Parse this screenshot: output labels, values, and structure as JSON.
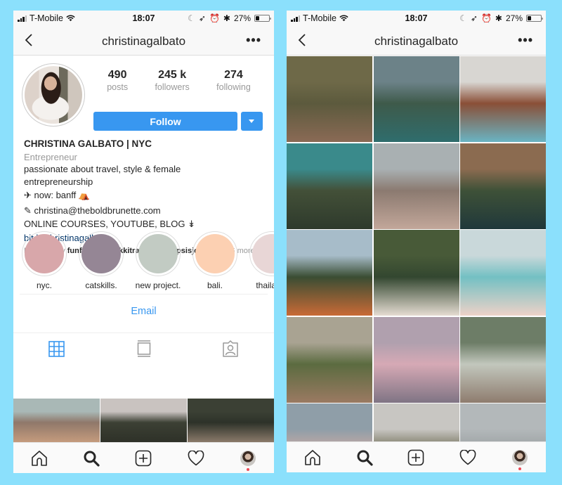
{
  "status_bar": {
    "carrier": "T-Mobile",
    "time": "18:07",
    "battery": "27%",
    "battery_level": 0.27,
    "icons": [
      "signal-icon",
      "wifi-icon",
      "moon-icon",
      "location-icon",
      "alarm-icon",
      "bluetooth-icon",
      "battery-icon"
    ]
  },
  "navbar": {
    "title": "christinagalbato",
    "back_icon": "chevron-left-icon",
    "more_label": "•••"
  },
  "profile": {
    "stats": [
      {
        "value": "490",
        "label": "posts"
      },
      {
        "value": "245 k",
        "label": "followers"
      },
      {
        "value": "274",
        "label": "following"
      }
    ],
    "follow_label": "Follow",
    "name": "CHRISTINA GALBATO | NYC",
    "category": "Entrepreneur",
    "bio_lines": [
      "passionate about travel, style & female",
      "entrepreneurship",
      "✈ now: banff ⛺",
      "✎ christina@theboldbrunette.com",
      "ONLINE COURSES, YOUTUBE, BLOG ↡"
    ],
    "link": "bit.ly/christinagalbato",
    "followed_by_prefix": "Followed by ",
    "followed_by_names": [
      "funforlouis",
      "nikkitravelled",
      "ellipsisjournals"
    ],
    "followed_by_suffix": " + 6 more"
  },
  "highlights": [
    {
      "label": "nyc.",
      "color": "#d8a7aa"
    },
    {
      "label": "catskills.",
      "color": "#958695"
    },
    {
      "label": "new project.",
      "color": "#c2cbc3"
    },
    {
      "label": "bali.",
      "color": "#fcd0b2"
    },
    {
      "label": "thailand.",
      "color": "#e8d6d6"
    }
  ],
  "email_label": "Email",
  "profile_tabs": [
    {
      "name": "grid",
      "icon": "grid-icon",
      "active": true
    },
    {
      "name": "feed",
      "icon": "feed-icon",
      "active": false
    },
    {
      "name": "tagged",
      "icon": "tagged-icon",
      "active": false
    }
  ],
  "accent_color": "#3897f0",
  "left_grid_previews": [
    {
      "desc": "rocky coast",
      "colors": [
        "#a9b8b6",
        "#8f786a",
        "#c59b7d"
      ]
    },
    {
      "desc": "forest hills under cloudy sky",
      "colors": [
        "#c9c3c0",
        "#3c4034",
        "#2e3128"
      ]
    },
    {
      "desc": "dense jungle",
      "colors": [
        "#3b4034",
        "#2d3229",
        "#8a7a6a"
      ]
    }
  ],
  "right_grid": [
    {
      "desc": "aerial rice terraces",
      "colors": [
        "#6e6948",
        "#5c5a3d",
        "#8a6a55"
      ]
    },
    {
      "desc": "woman on hill with mountains",
      "colors": [
        "#6c8288",
        "#3e5a4a",
        "#2f6d6d"
      ]
    },
    {
      "desc": "temple hotel pool",
      "colors": [
        "#d8d6d2",
        "#8a4f37",
        "#6ab4c3"
      ]
    },
    {
      "desc": "aerial palm and pool",
      "colors": [
        "#3a8a8b",
        "#435038",
        "#2e3a2c"
      ]
    },
    {
      "desc": "rooftop with balloons",
      "colors": [
        "#a9b0b2",
        "#8b7a70",
        "#c2a79a"
      ]
    },
    {
      "desc": "bamboo house and pool",
      "colors": [
        "#8b6b50",
        "#3e5138",
        "#20383a"
      ]
    },
    {
      "desc": "marigold field",
      "colors": [
        "#a7bcc9",
        "#3a4d33",
        "#c96a36"
      ]
    },
    {
      "desc": "jungle with hammock net",
      "colors": [
        "#485a38",
        "#334730",
        "#e5dcd2"
      ]
    },
    {
      "desc": "pink beach",
      "colors": [
        "#c9d8da",
        "#73c0c3",
        "#edd2c8"
      ]
    },
    {
      "desc": "woman by bathtub",
      "colors": [
        "#a9a392",
        "#5b6b40",
        "#9b7a62"
      ]
    },
    {
      "desc": "infinity pool at sunset",
      "colors": [
        "#b0a0ae",
        "#d6a9b5",
        "#7f7484"
      ]
    },
    {
      "desc": "woman in hammock",
      "colors": [
        "#6d7d67",
        "#c2c7bd",
        "#8e7c6e"
      ]
    },
    {
      "desc": "pink clouds",
      "colors": [
        "#8f9ea8",
        "#c8aaa4",
        "#d9c6c3"
      ]
    },
    {
      "desc": "palm trees",
      "colors": [
        "#c8c6c2",
        "#6c6a52",
        "#9b8a7a"
      ]
    },
    {
      "desc": "tree line under sky",
      "colors": [
        "#b3b8ba",
        "#9aa0a1",
        "#3e4232"
      ]
    }
  ],
  "tabbar": [
    {
      "name": "home",
      "icon": "home-icon"
    },
    {
      "name": "search",
      "icon": "search-icon"
    },
    {
      "name": "new-post",
      "icon": "add-post-icon"
    },
    {
      "name": "activity",
      "icon": "heart-icon"
    },
    {
      "name": "profile",
      "icon": "profile-avatar"
    }
  ]
}
